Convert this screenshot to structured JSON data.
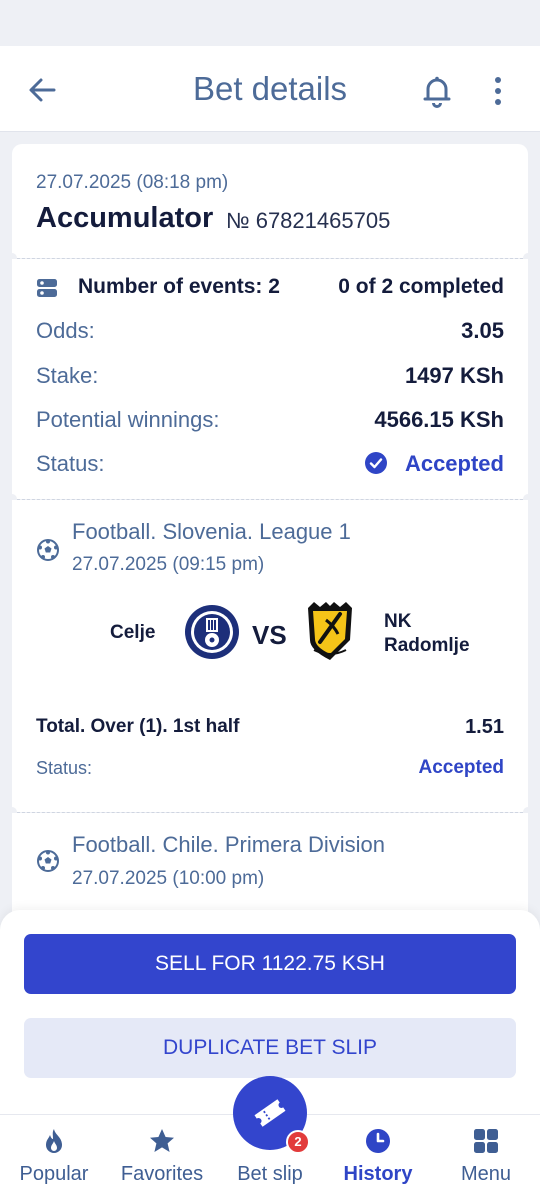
{
  "header": {
    "title": "Bet details",
    "back_icon": "arrow-left-icon",
    "bell_icon": "bell-icon",
    "more_icon": "more-vertical-icon"
  },
  "bet": {
    "placed_at": "27.07.2025 (08:18 pm)",
    "type": "Accumulator",
    "number": "№ 67821465705"
  },
  "summary": {
    "events_label": "Number of events: 2",
    "completed_label": "0 of 2 completed",
    "rows": [
      {
        "label": "Odds:",
        "value": "3.05"
      },
      {
        "label": "Stake:",
        "value": "1497 KSh"
      },
      {
        "label": "Potential winnings:",
        "value": "4566.15 KSh"
      }
    ],
    "status_label": "Status:",
    "status_value": "Accepted"
  },
  "events": [
    {
      "league": "Football. Slovenia. League 1",
      "date": "27.07.2025 (09:15 pm)",
      "home_team": "Celje",
      "away_team_line1": "NK",
      "away_team_line2": "Radomlje",
      "vs": "VS",
      "market": "Total. Over (1). 1st half",
      "odds": "1.51",
      "status_label": "Status:",
      "status_value": "Accepted"
    },
    {
      "league": "Football. Chile. Primera Division",
      "date": "27.07.2025 (10:00 pm)"
    }
  ],
  "actions": {
    "sell_label": "SELL FOR 1122.75 KSH",
    "duplicate_label": "DUPLICATE BET SLIP"
  },
  "tabbar": {
    "tabs": [
      {
        "label": "Popular",
        "icon": "flame-icon"
      },
      {
        "label": "Favorites",
        "icon": "star-icon"
      },
      {
        "label": "Bet slip",
        "icon": "ticket-icon"
      },
      {
        "label": "History",
        "icon": "clock-icon"
      },
      {
        "label": "Menu",
        "icon": "grid-icon"
      }
    ],
    "active": "History",
    "betslip_badge": "2"
  },
  "colors": {
    "primary": "#3345cd",
    "accent_text": "#4d6b98",
    "badge": "#e23b3b"
  }
}
